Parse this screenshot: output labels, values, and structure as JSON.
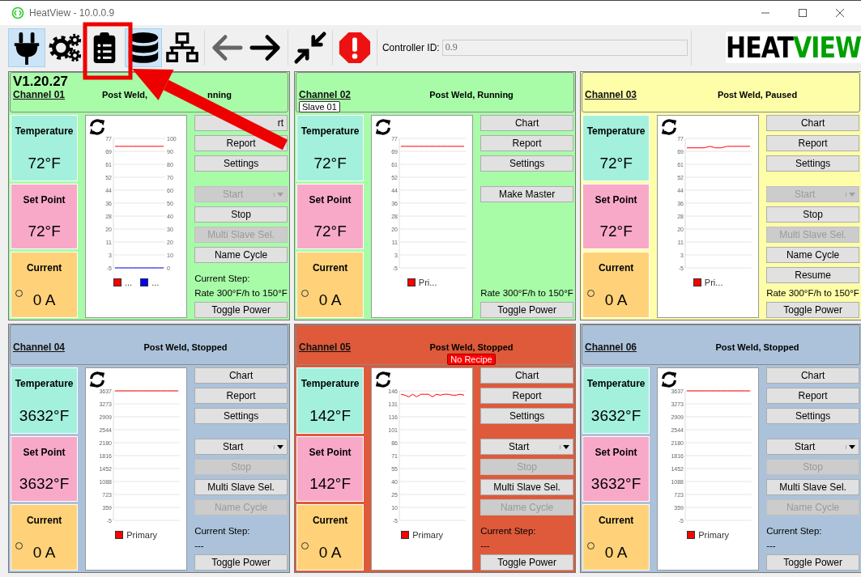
{
  "window": {
    "title": "HeatView - 10.0.0.9"
  },
  "toolbar_groups": [
    [
      {
        "selected": true,
        "disabled": false
      },
      {
        "selected": false,
        "disabled": false
      },
      {
        "selected": false,
        "disabled": false
      },
      {
        "selected": true,
        "disabled": false
      },
      {
        "selected": false,
        "disabled": false
      }
    ],
    [
      {
        "selected": false,
        "disabled": true
      },
      {
        "selected": false,
        "disabled": false
      }
    ],
    [
      {
        "selected": false,
        "disabled": false
      }
    ],
    [
      {
        "selected": false,
        "disabled": false
      }
    ]
  ],
  "controller_id": {
    "label": "Controller ID:",
    "value": "0.9",
    "disabled": true
  },
  "logo": {
    "first": "HEAT",
    "second": "VIEW"
  },
  "annotation": {
    "highlight_frame": true,
    "arrow": true
  },
  "channels": [
    {
      "name": "Channel 01",
      "version": "V1.20.27",
      "status": "Post Weld,",
      "status_tail": "nning",
      "color": "#a8fca8",
      "tiles": [
        {
          "kind": "temperature",
          "label": "Temperature",
          "value": "72°F"
        },
        {
          "kind": "setpoint",
          "label": "Set Point",
          "value": "72°F"
        },
        {
          "kind": "current",
          "label": "Current",
          "value": "0 A",
          "indicator_on": false
        }
      ],
      "chart_data": {
        "type": "line",
        "grid": true,
        "ylim": [
          -5,
          77
        ],
        "yticks": [
          77,
          69,
          61,
          52,
          44,
          36,
          28,
          20,
          11,
          3,
          -5
        ],
        "y2lim": [
          0,
          100
        ],
        "y2ticks": [
          100,
          90,
          80,
          70,
          60,
          50,
          40,
          30,
          20,
          10,
          0
        ],
        "series": [
          {
            "name": "...",
            "color": "#ff0000",
            "values": [
              72,
              72,
              72,
              72,
              72,
              72,
              72,
              72,
              72,
              72,
              72,
              72
            ]
          },
          {
            "name": "...",
            "color": "#0000ff",
            "axis": "y2",
            "values": [
              0,
              0,
              0,
              0,
              0,
              0,
              0,
              0,
              0,
              0,
              0,
              0
            ]
          }
        ]
      },
      "top_buttons": [
        {
          "label": "rt",
          "kind": "covered"
        },
        {
          "label": "Report",
          "kind": "button"
        },
        {
          "label": "Settings",
          "kind": "button"
        }
      ],
      "action_buttons": [
        {
          "label": "Start",
          "kind": "split",
          "disabled": true
        },
        {
          "label": "Stop",
          "kind": "button",
          "disabled": false
        },
        {
          "label": "Multi Slave Sel.",
          "kind": "button",
          "disabled": true
        },
        {
          "label": "Name Cycle",
          "kind": "button",
          "disabled": false
        }
      ],
      "step_label": "Current Step:",
      "step_value": "Rate 300°F/h to 150°F",
      "power_button": "Toggle Power"
    },
    {
      "name": "Channel 02",
      "status": "Post Weld, Running",
      "color": "#a8fca8",
      "badge": {
        "text": "Slave 01",
        "kind": "slave"
      },
      "tiles": [
        {
          "kind": "temperature",
          "label": "Temperature",
          "value": "72°F"
        },
        {
          "kind": "setpoint",
          "label": "Set Point",
          "value": "72°F"
        },
        {
          "kind": "current",
          "label": "Current",
          "value": "0 A",
          "indicator_on": false
        }
      ],
      "chart_data": {
        "type": "line",
        "grid": true,
        "ylim": [
          -5,
          77
        ],
        "yticks": [
          77,
          69,
          61,
          52,
          44,
          36,
          28,
          20,
          11,
          3,
          -5
        ],
        "series": [
          {
            "name": "Pri...",
            "color": "#ff0000",
            "values": [
              72,
              72,
              72,
              72,
              72,
              72,
              72,
              72,
              72,
              72,
              72,
              72
            ]
          }
        ]
      },
      "top_buttons": [
        {
          "label": "Chart",
          "kind": "button"
        },
        {
          "label": "Report",
          "kind": "button"
        },
        {
          "label": "Settings",
          "kind": "button"
        }
      ],
      "action_buttons": [
        {
          "label": "Make Master",
          "kind": "button",
          "disabled": false
        }
      ],
      "step_value": "Rate 300°F/h to 150°F",
      "power_button": "Toggle Power"
    },
    {
      "name": "Channel 03",
      "status": "Post Weld, Paused",
      "color": "#fefea8",
      "tiles": [
        {
          "kind": "temperature",
          "label": "Temperature",
          "value": "72°F"
        },
        {
          "kind": "setpoint",
          "label": "Set Point",
          "value": "72°F"
        },
        {
          "kind": "current",
          "label": "Current",
          "value": "0 A",
          "indicator_on": false
        }
      ],
      "chart_data": {
        "type": "line",
        "grid": true,
        "ylim": [
          -5,
          77
        ],
        "yticks": [
          77,
          69,
          61,
          52,
          44,
          36,
          28,
          20,
          11,
          3,
          -5
        ],
        "series": [
          {
            "name": "Pri...",
            "color": "#ff0000",
            "values": [
              71,
              71,
              71,
              71,
              72,
              71,
              71,
              72,
              72,
              72,
              72,
              72
            ]
          }
        ]
      },
      "top_buttons": [
        {
          "label": "Chart",
          "kind": "button"
        },
        {
          "label": "Report",
          "kind": "button"
        },
        {
          "label": "Settings",
          "kind": "button"
        }
      ],
      "action_buttons": [
        {
          "label": "Start",
          "kind": "split",
          "disabled": true
        },
        {
          "label": "Stop",
          "kind": "button",
          "disabled": false
        },
        {
          "label": "Multi Slave Sel.",
          "kind": "button",
          "disabled": true
        },
        {
          "label": "Name Cycle",
          "kind": "button",
          "disabled": false
        },
        {
          "label": "Resume",
          "kind": "button",
          "disabled": false
        }
      ],
      "step_value": "Rate 300°F/h to 150°F",
      "power_button": "Toggle Power"
    },
    {
      "name": "Channel 04",
      "status": "Post Weld, Stopped",
      "color": "#abc2da",
      "tiles": [
        {
          "kind": "temperature",
          "label": "Temperature",
          "value": "3632°F"
        },
        {
          "kind": "setpoint",
          "label": "Set Point",
          "value": "3632°F"
        },
        {
          "kind": "current",
          "label": "Current",
          "value": "0 A",
          "indicator_on": false
        }
      ],
      "chart_data": {
        "type": "line",
        "grid": true,
        "ylim": [
          -5,
          3637
        ],
        "yticks": [
          3637,
          3273,
          2909,
          2544,
          2180,
          1816,
          1452,
          1088,
          723,
          359,
          -5
        ],
        "series": [
          {
            "name": "Primary",
            "color": "#ff0000",
            "values": [
              3637,
              3637,
              3637,
              3637,
              3637,
              3637,
              3637,
              3637,
              3637,
              3637,
              3637,
              3637
            ]
          }
        ]
      },
      "top_buttons": [
        {
          "label": "Chart",
          "kind": "button"
        },
        {
          "label": "Report",
          "kind": "button"
        },
        {
          "label": "Settings",
          "kind": "button"
        }
      ],
      "action_buttons": [
        {
          "label": "Start",
          "kind": "split",
          "disabled": false
        },
        {
          "label": "Stop",
          "kind": "button",
          "disabled": true
        },
        {
          "label": "Multi Slave Sel.",
          "kind": "button",
          "disabled": false
        },
        {
          "label": "Name Cycle",
          "kind": "button",
          "disabled": true
        }
      ],
      "step_label": "Current Step:",
      "step_value": "---",
      "power_button": "Toggle Power"
    },
    {
      "name": "Channel 05",
      "status": "Post Weld, Stopped",
      "color": "#de5a3a",
      "badge": {
        "text": "No Recipe",
        "kind": "alert"
      },
      "tiles": [
        {
          "kind": "temperature",
          "label": "Temperature",
          "value": "142°F"
        },
        {
          "kind": "setpoint",
          "label": "Set Point",
          "value": "142°F"
        },
        {
          "kind": "current",
          "label": "Current",
          "value": "0 A",
          "indicator_on": false
        }
      ],
      "chart_data": {
        "type": "line",
        "grid": true,
        "ylim": [
          -5,
          146
        ],
        "yticks": [
          146,
          131,
          116,
          101,
          86,
          71,
          55,
          40,
          25,
          10,
          -5
        ],
        "series": [
          {
            "name": "Primary",
            "color": "#ff0000",
            "values": [
              142,
              141,
              139,
              142,
              139,
              142,
              142,
              142,
              139,
              142,
              141,
              142,
              142,
              141,
              141,
              142,
              141
            ]
          }
        ]
      },
      "top_buttons": [
        {
          "label": "Chart",
          "kind": "button"
        },
        {
          "label": "Report",
          "kind": "button"
        },
        {
          "label": "Settings",
          "kind": "button"
        }
      ],
      "action_buttons": [
        {
          "label": "Start",
          "kind": "split",
          "disabled": false
        },
        {
          "label": "Stop",
          "kind": "button",
          "disabled": true
        },
        {
          "label": "Multi Slave Sel.",
          "kind": "button",
          "disabled": false
        },
        {
          "label": "Name Cycle",
          "kind": "button",
          "disabled": true
        }
      ],
      "step_label": "Current Step:",
      "step_value": "---",
      "power_button": "Toggle Power"
    },
    {
      "name": "Channel 06",
      "status": "Post Weld, Stopped",
      "color": "#abc2da",
      "tiles": [
        {
          "kind": "temperature",
          "label": "Temperature",
          "value": "3632°F"
        },
        {
          "kind": "setpoint",
          "label": "Set Point",
          "value": "3632°F"
        },
        {
          "kind": "current",
          "label": "Current",
          "value": "0 A",
          "indicator_on": false
        }
      ],
      "chart_data": {
        "type": "line",
        "grid": true,
        "ylim": [
          -5,
          3637
        ],
        "yticks": [
          3637,
          3273,
          2909,
          2544,
          2180,
          1816,
          1452,
          1088,
          723,
          359,
          -5
        ],
        "series": [
          {
            "name": "Primary",
            "color": "#ff0000",
            "values": [
              3637,
              3637,
              3637,
              3637,
              3637,
              3637,
              3637,
              3637,
              3637,
              3637,
              3637,
              3637
            ]
          }
        ]
      },
      "top_buttons": [
        {
          "label": "Chart",
          "kind": "button"
        },
        {
          "label": "Report",
          "kind": "button"
        },
        {
          "label": "Settings",
          "kind": "button"
        }
      ],
      "action_buttons": [
        {
          "label": "Start",
          "kind": "split",
          "disabled": false
        },
        {
          "label": "Stop",
          "kind": "button",
          "disabled": true
        },
        {
          "label": "Multi Slave Sel.",
          "kind": "button",
          "disabled": false
        },
        {
          "label": "Name Cycle",
          "kind": "button",
          "disabled": true
        }
      ],
      "step_label": "Current Step:",
      "step_value": "---",
      "power_button": "Toggle Power"
    }
  ]
}
